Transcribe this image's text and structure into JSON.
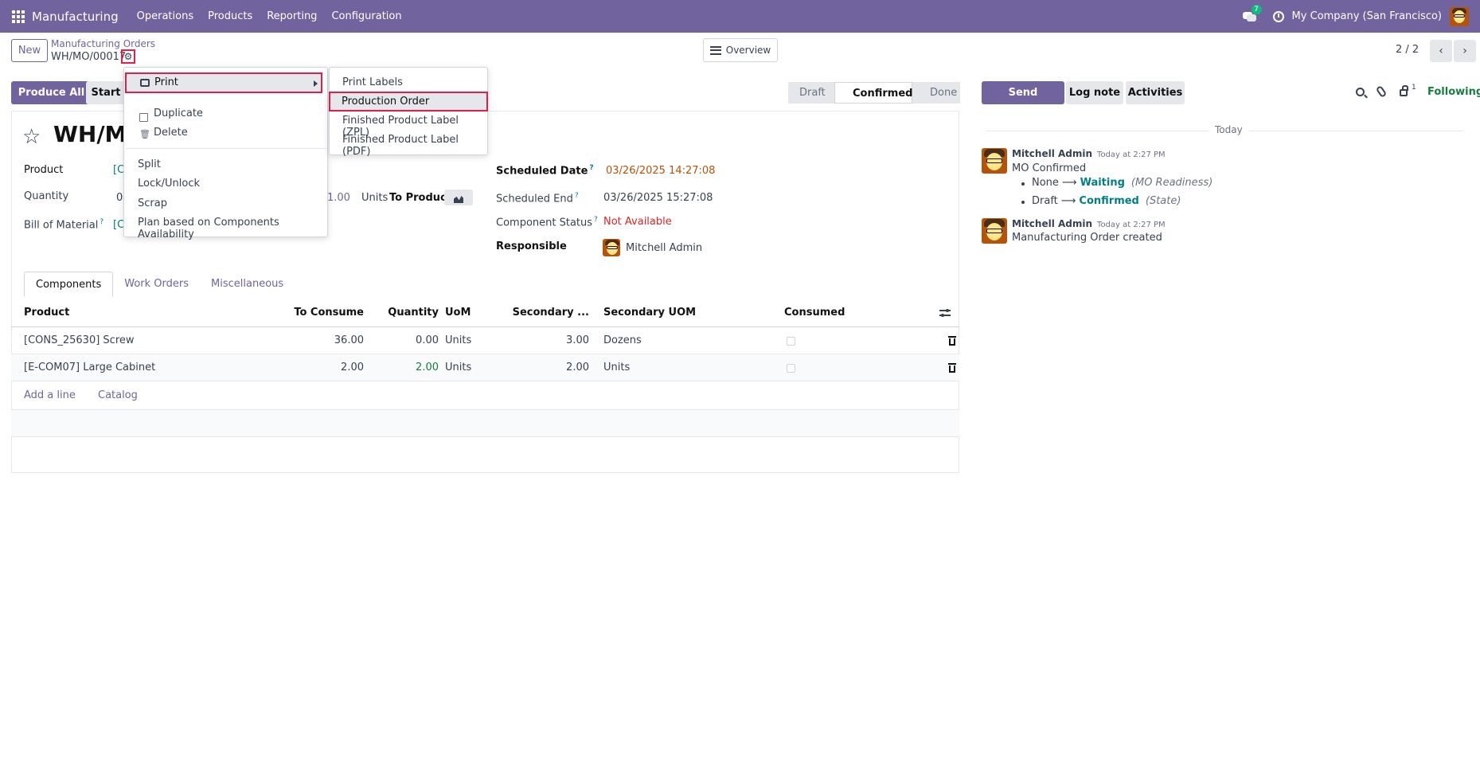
{
  "nav": {
    "app_name": "Manufacturing",
    "menus": [
      "Operations",
      "Products",
      "Reporting",
      "Configuration"
    ],
    "chat_count": "7",
    "company": "My Company (San Francisco)"
  },
  "control": {
    "new_label": "New",
    "breadcrumb_parent": "Manufacturing Orders",
    "breadcrumb_current": "WH/MO/00017",
    "overview_label": "Overview",
    "pager": "2 / 2"
  },
  "form": {
    "buttons": {
      "produce_all": "Produce All",
      "start": "Start"
    },
    "stages": [
      "Draft",
      "Confirmed",
      "Done"
    ],
    "active_stage": "Confirmed",
    "title": "WH/MC",
    "left_labels": {
      "product": "Product",
      "quantity": "Quantity",
      "bom": "Bill of Material"
    },
    "left_values": {
      "product": "[C",
      "quantity": "0",
      "bom": "[C",
      "qty_tail": "1.00"
    },
    "units_label": "Units",
    "to_produce_label": "To Produce",
    "right": {
      "scheduled_date_label": "Scheduled Date",
      "scheduled_date": "03/26/2025 14:27:08",
      "scheduled_end_label": "Scheduled End",
      "scheduled_end": "03/26/2025 15:27:08",
      "component_status_label": "Component Status",
      "component_status": "Not Available",
      "responsible_label": "Responsible",
      "responsible": "Mitchell Admin"
    }
  },
  "tabs": [
    "Components",
    "Work Orders",
    "Miscellaneous"
  ],
  "table": {
    "headers": [
      "Product",
      "To Consume",
      "Quantity",
      "UoM",
      "Secondary ...",
      "Secondary UOM",
      "Consumed"
    ],
    "rows": [
      [
        "[CONS_25630] Screw",
        "36.00",
        "0.00",
        "Units",
        "3.00",
        "Dozens"
      ],
      [
        "[E-COM07] Large Cabinet",
        "2.00",
        "2.00",
        "Units",
        "2.00",
        "Units"
      ]
    ],
    "add_line": "Add a line",
    "catalog": "Catalog"
  },
  "menu": {
    "print": "Print",
    "duplicate": "Duplicate",
    "delete": "Delete",
    "split": "Split",
    "lock_unlock": "Lock/Unlock",
    "scrap": "Scrap",
    "plan": "Plan based on Components Availability"
  },
  "print_submenu": [
    "Print Labels",
    "Production Order",
    "Finished Product Label (ZPL)",
    "Finished Product Label (PDF)"
  ],
  "chatter": {
    "send_message": "Send message",
    "log_note": "Log note",
    "activities": "Activities",
    "follower_count": "1",
    "following": "Following",
    "today": "Today",
    "messages": [
      {
        "author": "Mitchell Admin",
        "time": "Today at 2:27 PM",
        "body": "MO Confirmed",
        "tracking": [
          {
            "old": "None",
            "new": "Waiting",
            "field": "(MO Readiness)"
          },
          {
            "old": "Draft",
            "new": "Confirmed",
            "field": "(State)"
          }
        ]
      },
      {
        "author": "Mitchell Admin",
        "time": "Today at 2:27 PM",
        "body": "Manufacturing Order created"
      }
    ]
  },
  "colors": {
    "brand": "#71639e",
    "highlight_border": "#e11d48",
    "scheduled_date": "#b45309",
    "not_available": "#dc2626",
    "following": "#15803d"
  }
}
